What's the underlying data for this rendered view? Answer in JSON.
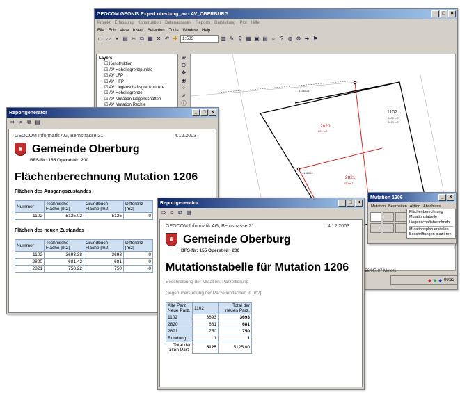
{
  "gis": {
    "title": "GEOCOM GEONIS Expert oberburg_av - AV_OBERBURG",
    "menu_top": [
      "Projekt",
      "Erfassung",
      "Konstruktion",
      "Datenauswahl",
      "Reports",
      "Darstellung",
      "Plot",
      "Hilfe"
    ],
    "menu": [
      "File",
      "Edit",
      "View",
      "Insert",
      "Selection",
      "Tools",
      "Window",
      "Help"
    ],
    "scale": "1:583",
    "layers_title": "Layers",
    "layers": [
      "Konstruktion",
      "AV Hoheitsgrenzpunkte",
      "AV LFP",
      "AV HFP",
      "AV Liegenschaftsgrenzpunkte",
      "AV Hoheitsgrenze",
      "AV Mutation Liegenschaften",
      "AV Mutation Rechte"
    ],
    "map_labels": {
      "p2820": "2820",
      "p2820_area": "681 m2",
      "p1102": "1102",
      "p1102_sub": "4685 m2",
      "p1102_area": "3693 m2",
      "p2821": "2821",
      "p2821_area": "750 m2",
      "pt1": "4146021",
      "pt2": "4146021"
    },
    "status_coords": "256447.87 Meters",
    "clock": "09:32"
  },
  "mut": {
    "title": "Mutation 1206",
    "menu": [
      "Mutation",
      "Bearbeiten",
      "Aktion",
      "Abschluss"
    ],
    "items": [
      "Flächenberechnung",
      "Mutationstabelle",
      "Liegenschaftsbeschrieb",
      "Mutationsplan erstellen",
      "Beschriftungen plazieren"
    ]
  },
  "rep1": {
    "title": "Reportgenerator",
    "company": "GEOCOM Informatik AG, Bernstrasse 21,",
    "date": "4.12.2003",
    "gemeinde": "Gemeinde Oberburg",
    "bfs": "BFS-Nr: 155 Operat-Nr: 200",
    "heading": "Flächenberechnung Mutation 1206",
    "sec1": "Flächen des Ausgangszustandes",
    "sec2": "Flächen des neuen Zustandes",
    "cols": [
      "Nummer",
      "Technische-Fläche [m2]",
      "Grundbuch-Fläche [m2]",
      "Differenz [m2]"
    ],
    "rows1": [
      [
        "1102",
        "5125.02",
        "5125",
        "-0"
      ]
    ],
    "rows2": [
      [
        "1102",
        "3693.38",
        "3693",
        "-0"
      ],
      [
        "2820",
        "681.42",
        "681",
        "-0"
      ],
      [
        "2821",
        "750.22",
        "750",
        "-0"
      ]
    ]
  },
  "rep2": {
    "title": "Reportgenerator",
    "company": "GEOCOM Informatik AG, Bernstrasse 21,",
    "date": "4.12.2003",
    "gemeinde": "Gemeinde Oberburg",
    "bfs": "BFS-Nr: 155 Operat-Nr: 200",
    "heading": "Mutationstabelle für Mutation 1206",
    "desc": "Beschreibung der Mutation: Parzellierung",
    "desc2": "Gegenüberstellung der Parzellenflächen in [m2]",
    "col_head": "Alte Parz. Neue Parz.",
    "col_old": "1102",
    "col_total": "Total der neuen Parz.",
    "rows": [
      [
        "1102",
        "3693",
        "3693"
      ],
      [
        "2820",
        "681",
        "681"
      ],
      [
        "2821",
        "750",
        "750"
      ],
      [
        "Rundung",
        "1",
        "1"
      ]
    ],
    "total_label": "Total der alten Parz.",
    "total_old": "5125",
    "total_new": "5125.00"
  }
}
